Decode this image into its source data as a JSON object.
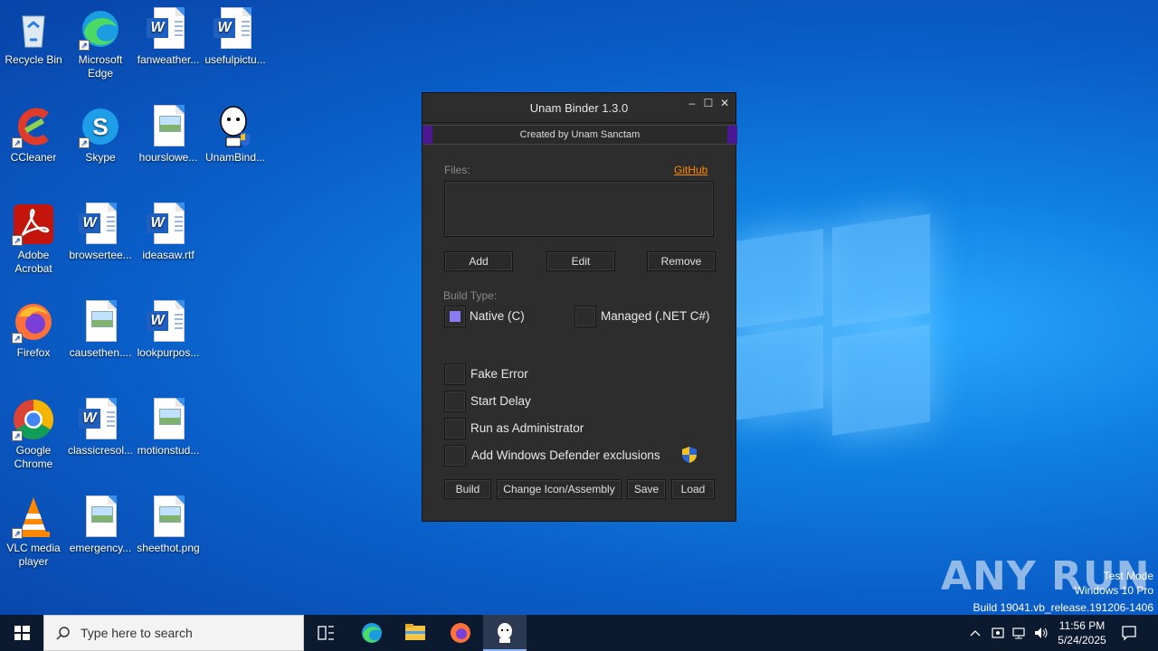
{
  "desktop": {
    "icons": [
      {
        "label": "Recycle Bin",
        "icon": "recycle-bin-icon"
      },
      {
        "label": "Microsoft Edge",
        "icon": "edge-icon"
      },
      {
        "label": "fanweather...",
        "icon": "word-doc-icon"
      },
      {
        "label": "usefulpictu...",
        "icon": "word-doc-icon"
      },
      {
        "label": "CCleaner",
        "icon": "ccleaner-icon"
      },
      {
        "label": "Skype",
        "icon": "skype-icon"
      },
      {
        "label": "hourslowe...",
        "icon": "image-file-icon"
      },
      {
        "label": "UnamBind...",
        "icon": "unam-binder-icon"
      },
      {
        "label": "Adobe Acrobat",
        "icon": "acrobat-icon"
      },
      {
        "label": "browsertee...",
        "icon": "word-doc-icon"
      },
      {
        "label": "ideasaw.rtf",
        "icon": "word-doc-icon"
      },
      {
        "label": "Firefox",
        "icon": "firefox-icon"
      },
      {
        "label": "causethen....",
        "icon": "image-file-icon"
      },
      {
        "label": "lookpurpos...",
        "icon": "word-doc-icon"
      },
      {
        "label": "Google Chrome",
        "icon": "chrome-icon"
      },
      {
        "label": "classicresol...",
        "icon": "word-doc-icon"
      },
      {
        "label": "motionstud...",
        "icon": "image-file-icon"
      },
      {
        "label": "VLC media player",
        "icon": "vlc-icon"
      },
      {
        "label": "emergency...",
        "icon": "image-file-icon"
      },
      {
        "label": "sheethot.png",
        "icon": "image-file-icon"
      }
    ]
  },
  "window": {
    "title": "Unam Binder 1.3.0",
    "subtitle": "Created by Unam Sanctam",
    "accent_color": "#4b1793",
    "files_label": "Files:",
    "github_link": "GitHub",
    "buttons": {
      "add": "Add",
      "edit": "Edit",
      "remove": "Remove"
    },
    "build_type_label": "Build Type:",
    "build_types": [
      {
        "label": "Native (C)",
        "checked": true
      },
      {
        "label": "Managed (.NET C#)",
        "checked": false
      }
    ],
    "options": [
      {
        "label": "Fake Error",
        "checked": false
      },
      {
        "label": "Start Delay",
        "checked": false
      },
      {
        "label": "Run as Administrator",
        "checked": false
      },
      {
        "label": "Add Windows Defender exclusions",
        "checked": false
      }
    ],
    "actions": {
      "build": "Build",
      "change_icon": "Change Icon/Assembly",
      "save": "Save",
      "load": "Load"
    }
  },
  "watermark": {
    "brand": "ANY RUN",
    "line1": "Test Mode",
    "line2": "Windows 10 Pro",
    "line3": "Build 19041.vb_release.191206-1406"
  },
  "taskbar": {
    "search_placeholder": "Type here to search",
    "time": "11:56 PM",
    "date": "5/24/2025"
  }
}
